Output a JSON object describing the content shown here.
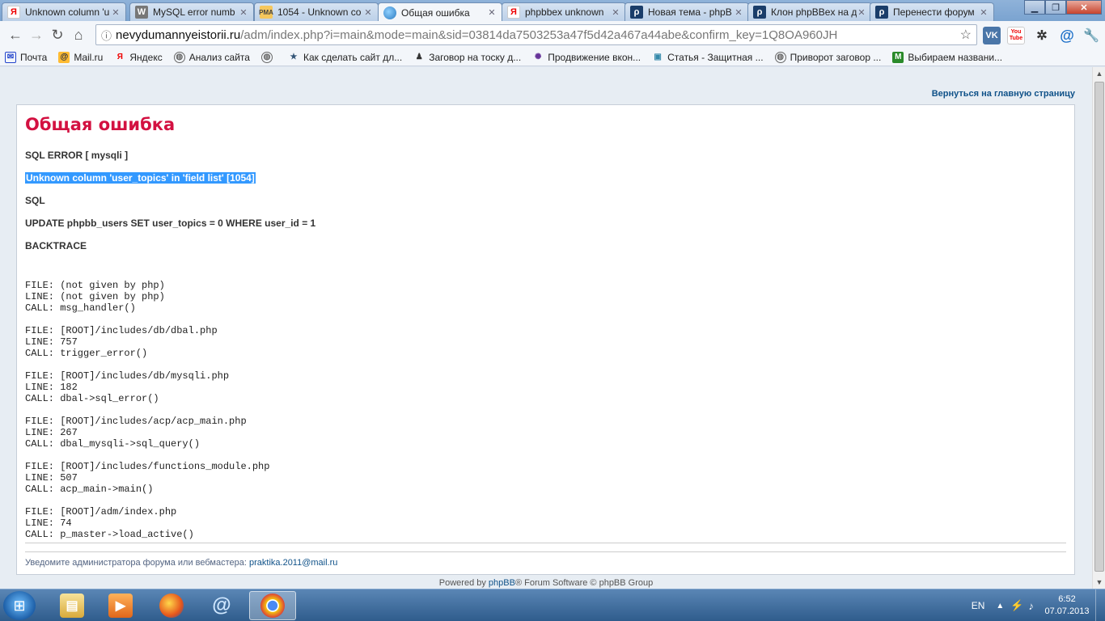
{
  "browser": {
    "tabs": [
      {
        "title": "Unknown column 'u",
        "icon": "yandex-icon"
      },
      {
        "title": "MySQL error numb",
        "icon": "w-icon"
      },
      {
        "title": "1054 - Unknown co",
        "icon": "pma-icon"
      },
      {
        "title": "Общая ошибка",
        "icon": "globe-icon",
        "active": true
      },
      {
        "title": "phpbbex unknown",
        "icon": "yandex-icon"
      },
      {
        "title": "Новая тема - phpB",
        "icon": "phpbbex-icon"
      },
      {
        "title": "Клон phpBBex на д",
        "icon": "phpbbex-icon"
      },
      {
        "title": "Перенести форум",
        "icon": "phpbbex-icon"
      }
    ],
    "url_host": "nevydumannyeistorii.ru",
    "url_rest": "/adm/index.php?i=main&mode=main&sid=03814da7503253a47f5d42a467a44abe&confirm_key=1Q8OA960JH",
    "extensions": {
      "vk": "VK",
      "youtube": "You Tube",
      "mailru": "@"
    },
    "bookmarks": [
      {
        "label": "Почта",
        "icon": "mail-icon"
      },
      {
        "label": "Mail.ru",
        "icon": "mailru-icon"
      },
      {
        "label": "Яндекс",
        "icon": "yandex-icon"
      },
      {
        "label": "Анализ сайта",
        "icon": "globe-icon"
      },
      {
        "label": "",
        "icon": "globe-icon"
      },
      {
        "label": "Как сделать сайт дл...",
        "icon": "star-icon"
      },
      {
        "label": "Заговор на тоску д...",
        "icon": "figure-icon"
      },
      {
        "label": "Продвижение вкон...",
        "icon": "spark-icon"
      },
      {
        "label": "Статья - Защитная ...",
        "icon": "image-icon"
      },
      {
        "label": "Приворот заговор ...",
        "icon": "globe-icon"
      },
      {
        "label": "Выбираем названи...",
        "icon": "m-icon"
      }
    ]
  },
  "page": {
    "back_link": "Вернуться на главную страницу",
    "title": "Общая ошибка",
    "sql_error_label": "SQL ERROR [ mysqli ]",
    "error_message": "Unknown column 'user_topics' in 'field list' [1054]",
    "sql_label": "SQL",
    "sql_query": "UPDATE phpbb_users SET user_topics = 0 WHERE user_id = 1",
    "backtrace_label": "BACKTRACE",
    "backtrace": [
      {
        "file": "FILE: (not given by php)",
        "line": "LINE: (not given by php)",
        "call": "CALL: msg_handler()"
      },
      {
        "file": "FILE: [ROOT]/includes/db/dbal.php",
        "line": "LINE: 757",
        "call": "CALL: trigger_error()"
      },
      {
        "file": "FILE: [ROOT]/includes/db/mysqli.php",
        "line": "LINE: 182",
        "call": "CALL: dbal->sql_error()"
      },
      {
        "file": "FILE: [ROOT]/includes/acp/acp_main.php",
        "line": "LINE: 267",
        "call": "CALL: dbal_mysqli->sql_query()"
      },
      {
        "file": "FILE: [ROOT]/includes/functions_module.php",
        "line": "LINE: 507",
        "call": "CALL: acp_main->main()"
      },
      {
        "file": "FILE: [ROOT]/adm/index.php",
        "line": "LINE: 74",
        "call": "CALL: p_master->load_active()"
      }
    ],
    "notify_text": "Уведомите администратора форума или вебмастера: ",
    "notify_email": "praktika.2011@mail.ru",
    "powered_prefix": "Powered by ",
    "powered_link": "phpBB",
    "powered_suffix": "® Forum Software © phpBB Group"
  },
  "taskbar": {
    "language": "EN",
    "time": "6:52",
    "date": "07.07.2013"
  }
}
